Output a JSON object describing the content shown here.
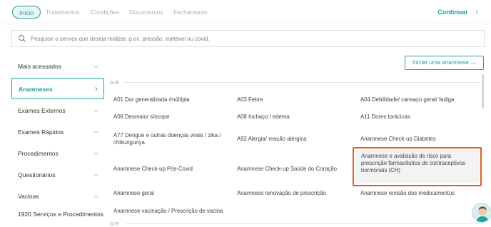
{
  "tabs": [
    {
      "label": "Início",
      "active": true
    },
    {
      "label": "Tratamentos",
      "active": false
    },
    {
      "label": "Condições",
      "active": false
    },
    {
      "label": "Documentos",
      "active": false
    },
    {
      "label": "Fechamento",
      "active": false
    }
  ],
  "continue_label": "Continuar",
  "search": {
    "placeholder": "Pesquise o serviço que deseja realizar, p.ex. pressão, injetável ou covid."
  },
  "sidebar": {
    "items": [
      {
        "label": "Mais acessados"
      },
      {
        "label": "Anamneses",
        "active": true
      },
      {
        "label": "Exames Externos"
      },
      {
        "label": "Exames Rápidos"
      },
      {
        "label": "Procedimentos"
      },
      {
        "label": "Questionários"
      },
      {
        "label": "Vacinas"
      },
      {
        "label": "1920 Serviços e Procedimentos"
      }
    ]
  },
  "start_button": {
    "label": "Iniciar uma anamnese"
  },
  "sections": [
    {
      "label": "A-B"
    },
    {
      "label": "D-E"
    }
  ],
  "services": {
    "r1c1": "A01 Dor generalizada /múltipla",
    "r1c2": "A03 Febre",
    "r1c3": "A04 Debilidade/ cansaço geral/ fadiga",
    "r2c1": "A06 Desmaio/ síncope",
    "r2c2": "A08 Inchaço / edema",
    "r2c3": "A11 Dores torácicas",
    "r3c1": "A77 Dengue e outras doenças virais / zika / chikungunya",
    "r3c2": "A92 Alergia/ reação alérgica",
    "r3c3": "Anamnese Check-up Diabetes",
    "r4c1": "Anamnese Check-up Pós-Covid",
    "r4c2": "Anamnese Check-up Saúde do Coração",
    "r4c3": "Anamnese e avaliação de risco para prescrição farmacêutica de contraceptivos hormonais (CH)",
    "r5c1": "Anamnese geral",
    "r5c2": "Anamnese renovação de prescrição",
    "r5c3": "Anamnese revisão dos medicamentos",
    "r6c1": "Anamnese vacinação / Prescrição de vacina"
  },
  "colors": {
    "accent": "#1aa39a",
    "highlight_border": "#e85a1d"
  }
}
